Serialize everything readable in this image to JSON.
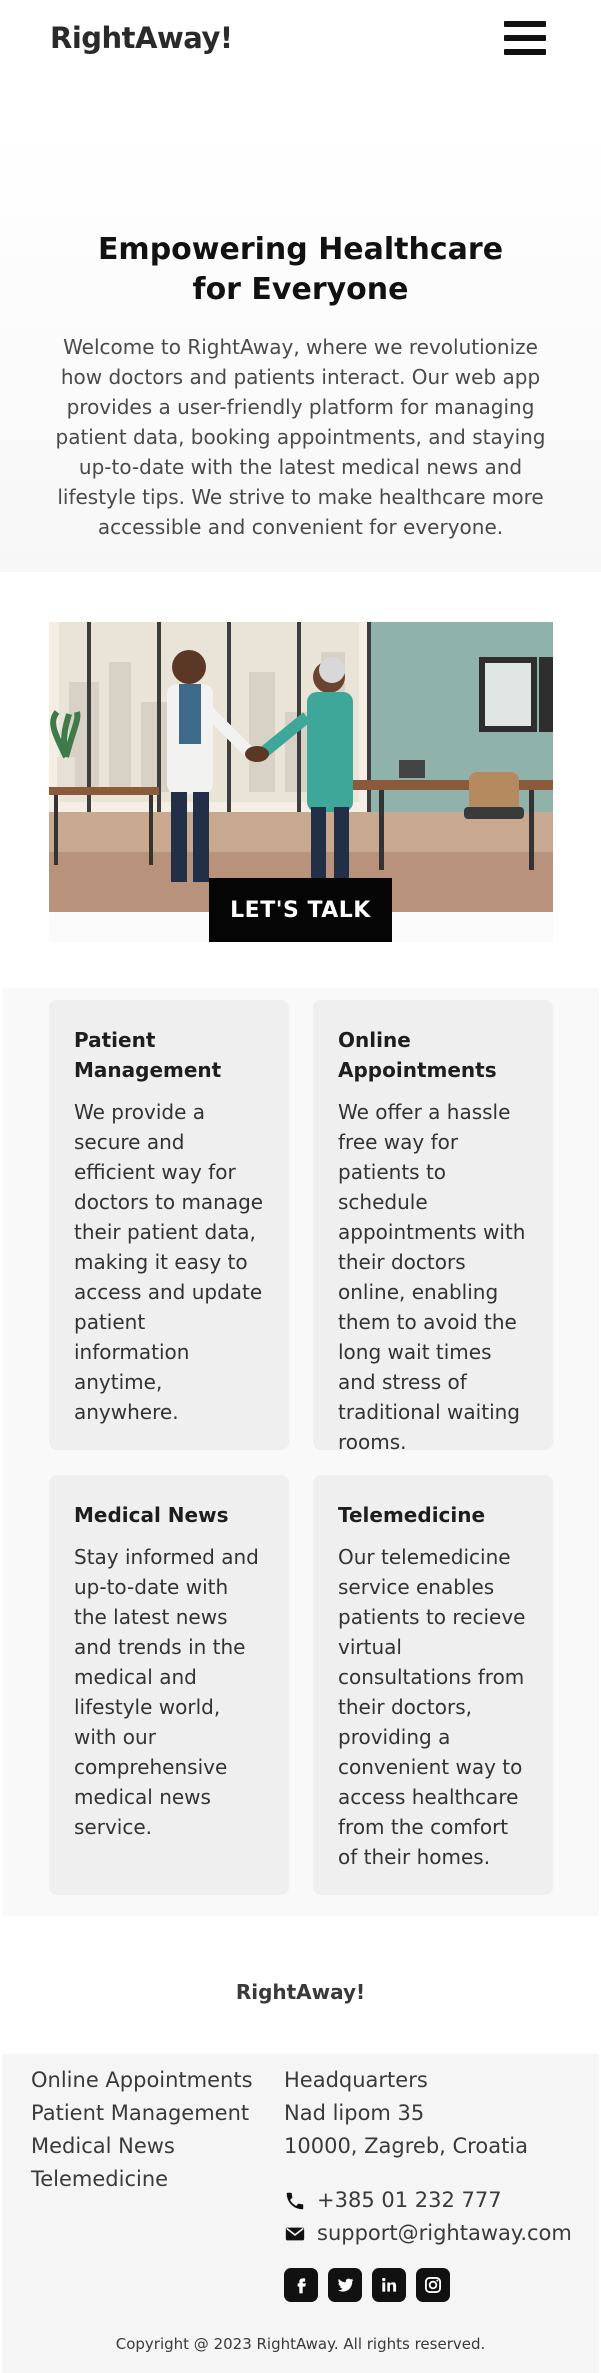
{
  "header": {
    "logo": "RightAway!",
    "menu_icon": "hamburger-menu-icon"
  },
  "hero": {
    "title": "Empowering Healthcare for Everyone",
    "description": "Welcome to RightAway, where we revolutionize how doctors and patients interact. Our web app provides a user-friendly platform for managing patient data, booking appointments, and staying up-to-date with the latest medical news and lifestyle tips. We strive to make healthcare more accessible and convenient for everyone."
  },
  "cta": {
    "label": "LET'S TALK"
  },
  "features": [
    {
      "title": "Patient Management",
      "text": "We provide a secure and efficient way for doctors to manage their patient data, making it easy to access and update patient information anytime, anywhere."
    },
    {
      "title": "Online Appointments",
      "text": "We offer a hassle free way for patients to schedule appointments with their doctors online, enabling them to avoid the long wait times and stress of traditional waiting rooms."
    },
    {
      "title": "Medical News",
      "text": "Stay informed and up-to-date with the latest news and trends in the medical and lifestyle world, with our comprehensive medical news service."
    },
    {
      "title": "Telemedicine",
      "text": "Our telemedicine service enables patients to recieve virtual consultations from their doctors, providing a convenient way to access healthcare from the comfort of their homes."
    }
  ],
  "footer": {
    "brand": "RightAway!",
    "links": [
      "Online Appointments",
      "Patient Management",
      "Medical News",
      "Telemedicine"
    ],
    "address": {
      "label": "Headquarters",
      "street": "Nad lipom 35",
      "city": "10000, Zagreb, Croatia"
    },
    "phone": "+385 01 232 777",
    "email": "support@rightaway.com",
    "socials": [
      "facebook-icon",
      "twitter-icon",
      "linkedin-icon",
      "instagram-icon"
    ],
    "copyright": "Copyright @ 2023 RightAway. All rights reserved."
  }
}
